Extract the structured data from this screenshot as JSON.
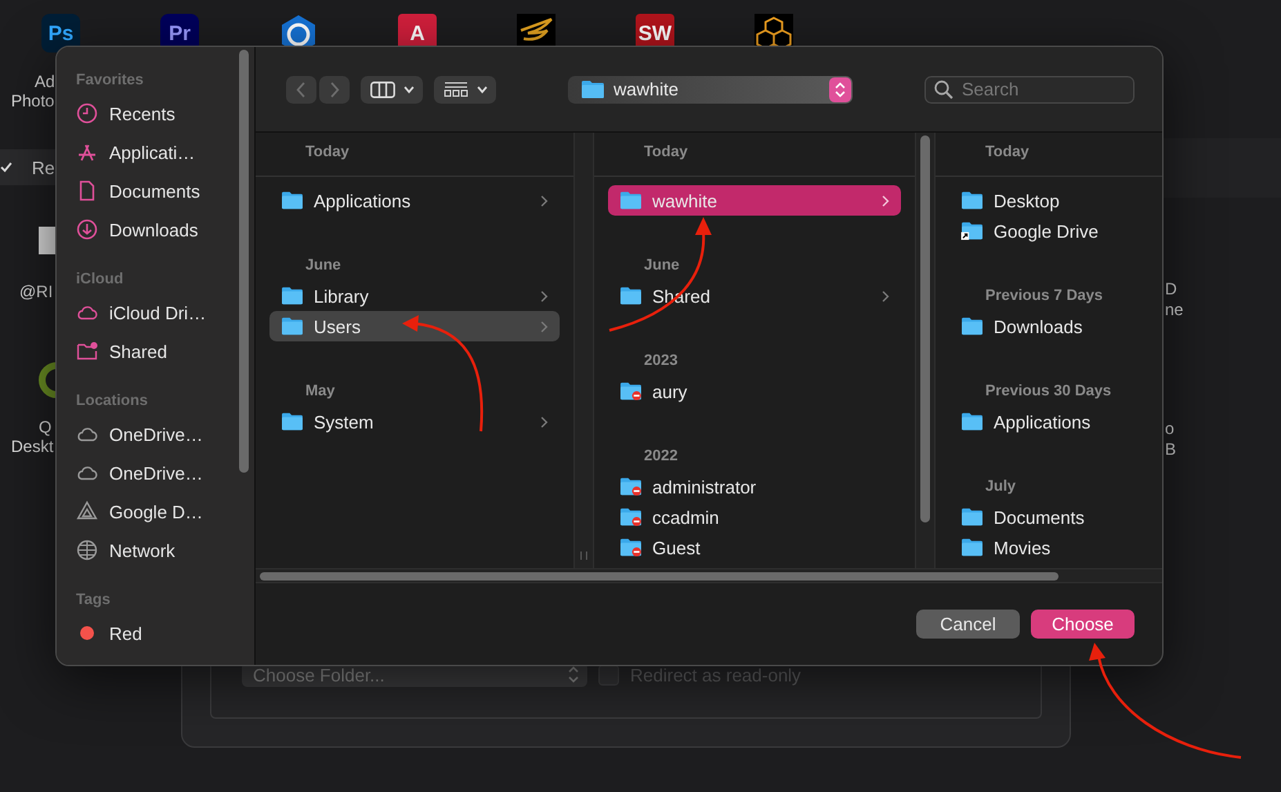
{
  "desktop_icons": [
    {
      "kind": "ps",
      "text": "Ps"
    },
    {
      "kind": "pr",
      "text": "Pr"
    },
    {
      "kind": "globe"
    },
    {
      "kind": "letter",
      "text": "A"
    },
    {
      "kind": "wings"
    },
    {
      "kind": "sw",
      "text": "SW"
    },
    {
      "kind": "cubes"
    }
  ],
  "background": {
    "left_labels": [
      {
        "text": "Ad"
      },
      {
        "text": "Photo"
      },
      {
        "text": "@RI"
      },
      {
        "text": "Q"
      },
      {
        "text": "Deskt"
      }
    ],
    "row_label": "Re",
    "right_labels": [
      {
        "text": "D"
      },
      {
        "text": "ne"
      },
      {
        "text": "o"
      },
      {
        "text": "B"
      }
    ],
    "folder_select": {
      "value": "Choose Folder..."
    },
    "redirect": {
      "label": "Redirect as read-only",
      "checked": false
    }
  },
  "dialog": {
    "sidebar": [
      {
        "title": "Favorites",
        "items": [
          {
            "label": "Recents",
            "kind": "recents"
          },
          {
            "label": "Applicati…",
            "kind": "applications"
          },
          {
            "label": "Documents",
            "kind": "document"
          },
          {
            "label": "Downloads",
            "kind": "downloads"
          }
        ]
      },
      {
        "title": "iCloud",
        "items": [
          {
            "label": "iCloud Dri…",
            "kind": "icloud"
          },
          {
            "label": "Shared",
            "kind": "shared"
          }
        ]
      },
      {
        "title": "Locations",
        "items": [
          {
            "label": "OneDrive…",
            "kind": "cloud"
          },
          {
            "label": "OneDrive…",
            "kind": "cloud"
          },
          {
            "label": "Google D…",
            "kind": "gdrive"
          },
          {
            "label": "Network",
            "kind": "network"
          }
        ]
      },
      {
        "title": "Tags",
        "items": [
          {
            "label": "Red",
            "kind": "tag",
            "color": "#f4524b"
          }
        ]
      }
    ],
    "toolbar": {
      "path": "wawhite",
      "search": {
        "placeholder": "Search"
      }
    },
    "columns": [
      {
        "groups": [
          {
            "title": "Today",
            "items": [
              {
                "label": "Applications",
                "kind": "folder",
                "selected": false,
                "has_children": true
              }
            ]
          },
          {
            "title": "June",
            "items": [
              {
                "label": "Library",
                "kind": "folder",
                "selected": false,
                "has_children": true
              },
              {
                "label": "Users",
                "kind": "folder",
                "selected": true,
                "has_children": true
              }
            ]
          },
          {
            "title": "May",
            "items": [
              {
                "label": "System",
                "kind": "folder",
                "selected": false,
                "has_children": true
              }
            ]
          }
        ]
      },
      {
        "groups": [
          {
            "title": "Today",
            "items": [
              {
                "label": "wawhite",
                "kind": "folder",
                "selected": true,
                "has_children": true
              }
            ]
          },
          {
            "title": "June",
            "items": [
              {
                "label": "Shared",
                "kind": "folder",
                "selected": false,
                "has_children": true
              }
            ]
          },
          {
            "title": "2023",
            "items": [
              {
                "label": "aury",
                "kind": "restricted",
                "selected": false,
                "has_children": false
              }
            ]
          },
          {
            "title": "2022",
            "items": [
              {
                "label": "administrator",
                "kind": "restricted",
                "selected": false,
                "has_children": false
              },
              {
                "label": "ccadmin",
                "kind": "restricted",
                "selected": false,
                "has_children": false
              },
              {
                "label": "Guest",
                "kind": "restricted",
                "selected": false,
                "has_children": false
              }
            ]
          }
        ]
      },
      {
        "groups": [
          {
            "title": "Today",
            "items": [
              {
                "label": "Desktop",
                "kind": "folder",
                "selected": false,
                "has_children": false
              },
              {
                "label": "Google Drive",
                "kind": "alias",
                "selected": false,
                "has_children": false
              }
            ]
          },
          {
            "title": "Previous 7 Days",
            "items": [
              {
                "label": "Downloads",
                "kind": "folder",
                "selected": false,
                "has_children": false
              }
            ]
          },
          {
            "title": "Previous 30 Days",
            "items": [
              {
                "label": "Applications",
                "kind": "folder",
                "selected": false,
                "has_children": false
              }
            ]
          },
          {
            "title": "July",
            "items": [
              {
                "label": "Documents",
                "kind": "folder",
                "selected": false,
                "has_children": false
              },
              {
                "label": "Movies",
                "kind": "folder",
                "selected": false,
                "has_children": false
              }
            ]
          }
        ]
      }
    ],
    "buttons": [
      {
        "label": "Cancel",
        "kind": "secondary"
      },
      {
        "label": "Choose",
        "kind": "primary"
      }
    ]
  }
}
